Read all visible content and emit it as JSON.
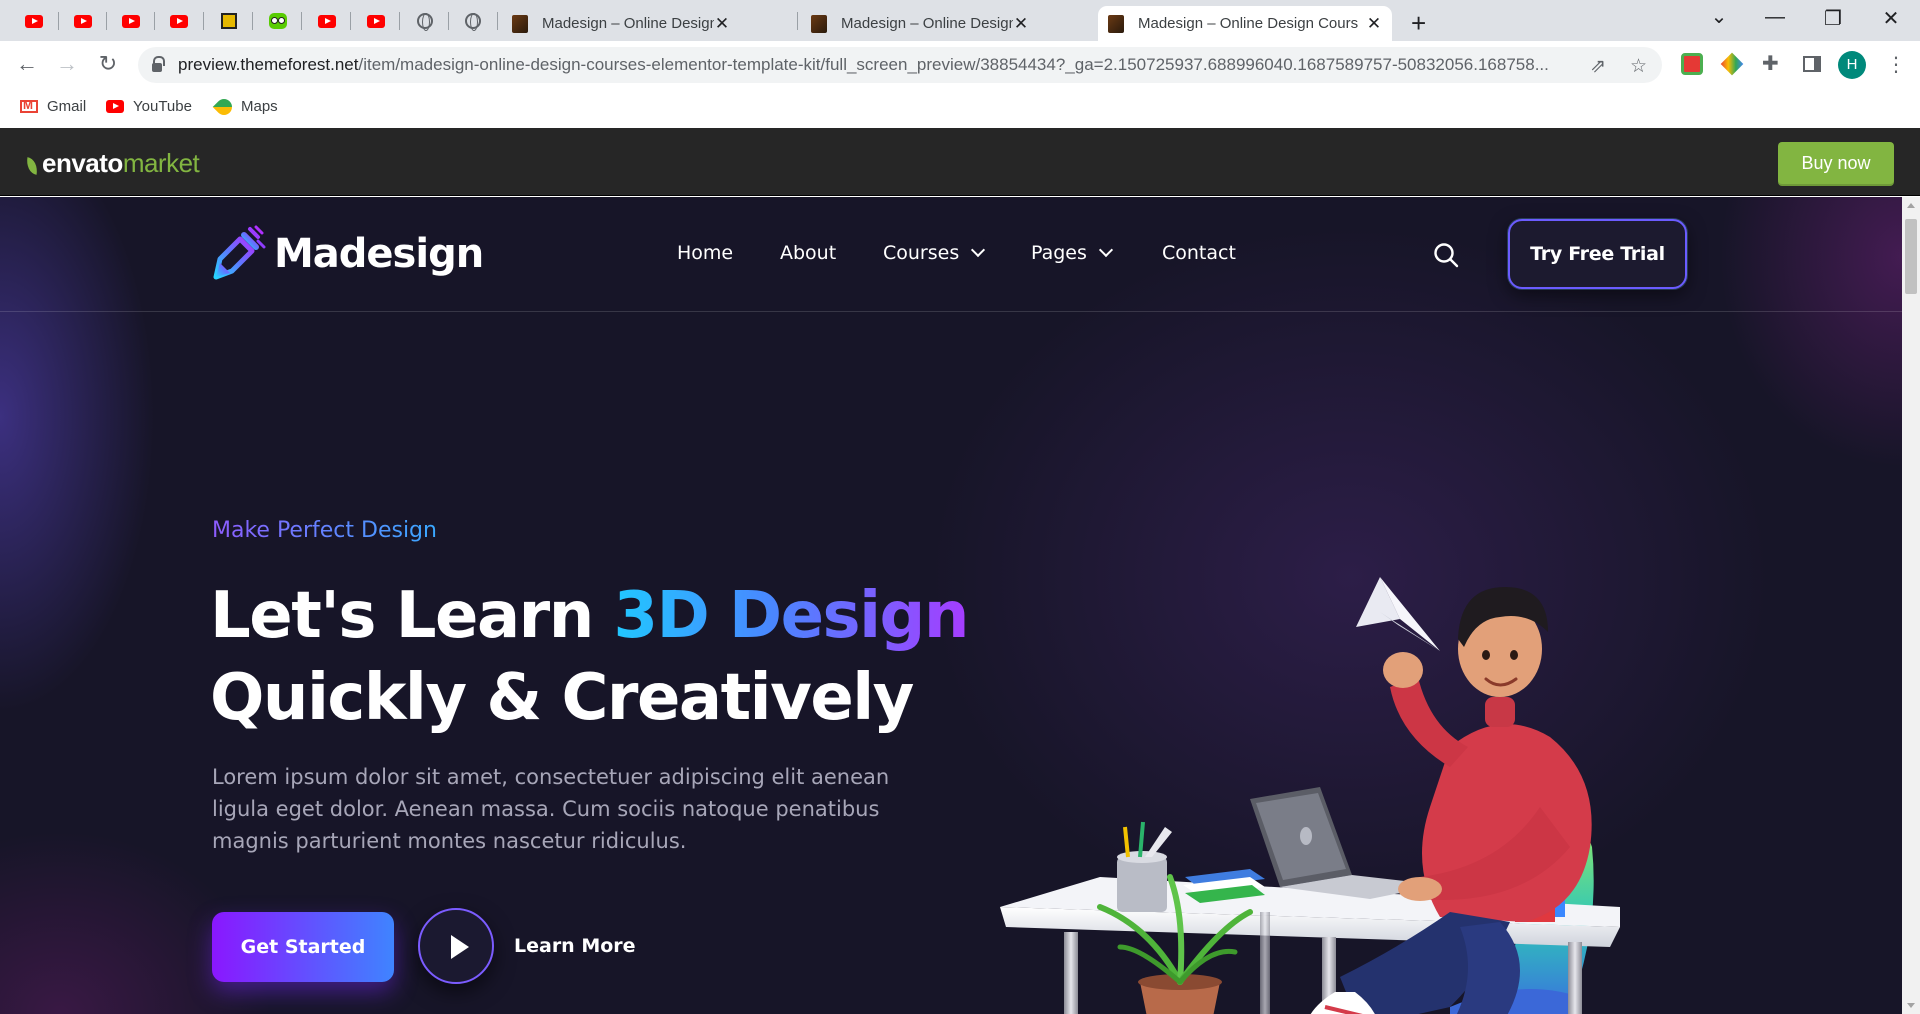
{
  "browser": {
    "tabs": [
      {
        "title": "Madesign – Online Design Cours",
        "close": "✕",
        "active": false
      },
      {
        "title": "Madesign – Online Design Cours",
        "close": "✕",
        "active": false
      },
      {
        "title": "Madesign – Online Design Cours",
        "close": "✕",
        "active": true
      }
    ],
    "new_tab": "+",
    "window_controls": {
      "tab_search": "⌄",
      "minimize": "—",
      "restore": "❐",
      "close": "✕"
    },
    "nav": {
      "back": "←",
      "forward": "→",
      "reload": "↻"
    },
    "url_host": "preview.themeforest.net",
    "url_path": "/item/madesign-online-design-courses-elementor-template-kit/full_screen_preview/38854434?_ga=2.150725937.688996040.1687589757-50832056.168758...",
    "profile_initial": "H",
    "menu": "⋮",
    "bookmarks": [
      {
        "label": "Gmail",
        "icon": "gmail-icon"
      },
      {
        "label": "YouTube",
        "icon": "youtube-icon"
      },
      {
        "label": "Maps",
        "icon": "maps-icon"
      }
    ]
  },
  "envato": {
    "logo_envato": "envato",
    "logo_market": "market",
    "buy_label": "Buy now",
    "brand_color": "#82b541"
  },
  "site": {
    "brand": "Madesign",
    "nav": [
      {
        "label": "Home",
        "dropdown": false
      },
      {
        "label": "About",
        "dropdown": false
      },
      {
        "label": "Courses",
        "dropdown": true
      },
      {
        "label": "Pages",
        "dropdown": true
      },
      {
        "label": "Contact",
        "dropdown": false
      }
    ],
    "cta": "Try Free Trial",
    "hero": {
      "eyebrow": "Make Perfect Design",
      "headline_part1": "Let's Learn ",
      "headline_highlight": "3D Design",
      "headline_line2": "Quickly & Creatively",
      "body": "Lorem ipsum dolor sit amet, consectetuer adipiscing elit aenean ligula eget dolor. Aenean massa. Cum sociis natoque penatibus magnis parturient montes nascetur ridiculus.",
      "primary_button": "Get Started",
      "secondary_button": "Learn More"
    },
    "colors": {
      "background": "#171528",
      "accent_purple": "#8a17ff",
      "accent_blue": "#3f84ff"
    }
  }
}
